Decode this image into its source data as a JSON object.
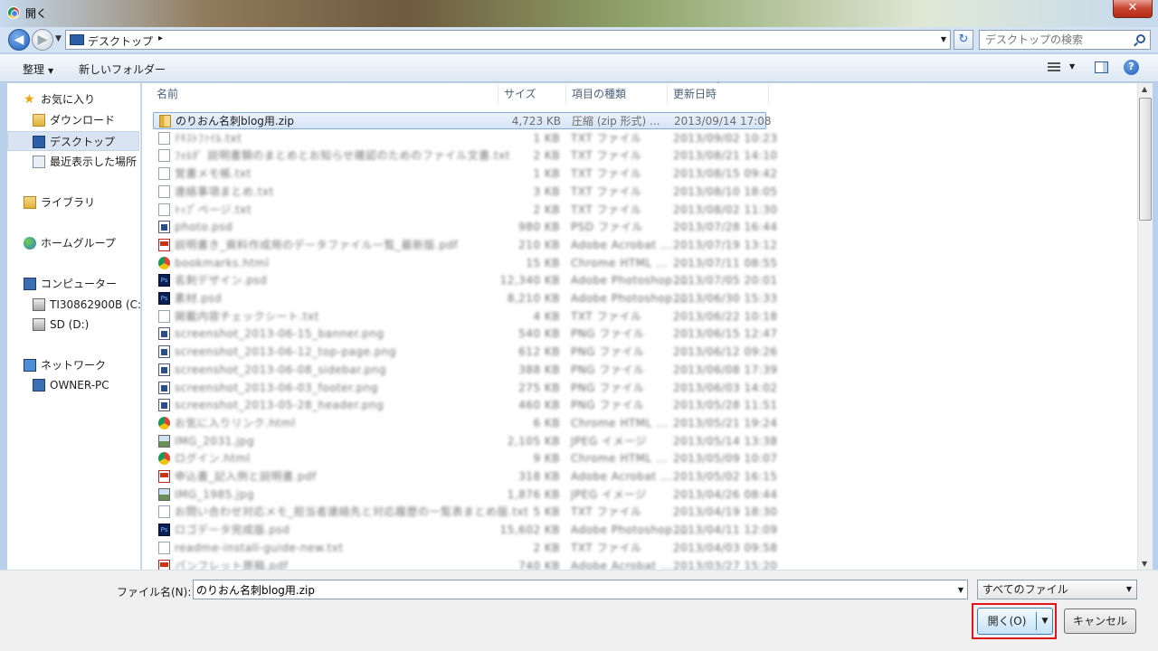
{
  "window": {
    "title": "開く",
    "close_glyph": "✕"
  },
  "address": {
    "back_glyph": "◀",
    "forward_glyph": "▶",
    "dropdown_glyph": "▼",
    "path_label": "デスクトップ",
    "path_arrow": "▸",
    "refresh_glyph": "↻",
    "search_placeholder": "デスクトップの検索"
  },
  "toolbar": {
    "organize_label": "整理",
    "dropdown_glyph": "▼",
    "new_folder_label": "新しいフォルダー",
    "help_glyph": "?"
  },
  "sidebar": {
    "items": [
      {
        "label": "お気に入り",
        "icon": "star-icon"
      },
      {
        "label": "ダウンロード",
        "icon": "folder-icon"
      },
      {
        "label": "デスクトップ",
        "icon": "desktop-icon",
        "selected": true
      },
      {
        "label": "最近表示した場所",
        "icon": "recent-places-icon"
      },
      {
        "label": "ライブラリ",
        "icon": "library-icon"
      },
      {
        "label": "ホームグループ",
        "icon": "homegroup-icon"
      },
      {
        "label": "コンピューター",
        "icon": "computer-icon"
      },
      {
        "label": "TI30862900B (C:)",
        "icon": "drive-icon"
      },
      {
        "label": "SD (D:)",
        "icon": "drive-icon"
      },
      {
        "label": "ネットワーク",
        "icon": "network-icon"
      },
      {
        "label": "OWNER-PC",
        "icon": "pc-icon"
      }
    ]
  },
  "columns": {
    "name": "名前",
    "size": "サイズ",
    "type": "項目の種類",
    "date": "更新日時",
    "sort_glyph": "ˇ"
  },
  "files": [
    {
      "name": "のりおん名刺blog用.zip",
      "size": "4,723 KB",
      "type": "圧縮 (zip 形式) ...",
      "date": "2013/09/14 17:08",
      "icon": "zip",
      "selected": true
    },
    {
      "name": "ﾃｷｽﾄﾌｧｲﾙ.txt",
      "size": "1 KB",
      "type": "TXT ファイル",
      "date": "2013/09/02 10:23",
      "icon": "doc",
      "blurred": true
    },
    {
      "name": "ﾌｫﾙﾀﾞ 説明書類のまとめとお知らせ確認のためのファイル文書.txt",
      "size": "2 KB",
      "type": "TXT ファイル",
      "date": "2013/08/21 14:10",
      "icon": "doc",
      "blurred": true
    },
    {
      "name": "覚書メモ帳.txt",
      "size": "1 KB",
      "type": "TXT ファイル",
      "date": "2013/08/15 09:42",
      "icon": "doc",
      "blurred": true
    },
    {
      "name": "連絡事項まとめ.txt",
      "size": "3 KB",
      "type": "TXT ファイル",
      "date": "2013/08/10 18:05",
      "icon": "doc",
      "blurred": true
    },
    {
      "name": "ﾄｯﾌﾟページ.txt",
      "size": "2 KB",
      "type": "TXT ファイル",
      "date": "2013/08/02 11:30",
      "icon": "doc",
      "blurred": true
    },
    {
      "name": "photo.psd",
      "size": "980 KB",
      "type": "PSD ファイル",
      "date": "2013/07/28 16:44",
      "icon": "img",
      "blurred": true
    },
    {
      "name": "説明書き_資料作成用のデータファイル一覧_最新版.pdf",
      "size": "210 KB",
      "type": "Adobe Acrobat ...",
      "date": "2013/07/19 13:12",
      "icon": "pdf",
      "blurred": true
    },
    {
      "name": "bookmarks.html",
      "size": "15 KB",
      "type": "Chrome HTML ...",
      "date": "2013/07/11 08:55",
      "icon": "chrome",
      "blurred": true
    },
    {
      "name": "名刺デザイン.psd",
      "size": "12,340 KB",
      "type": "Adobe Photoshop ...",
      "date": "2013/07/05 20:01",
      "icon": "ps",
      "blurred": true
    },
    {
      "name": "素材.psd",
      "size": "8,210 KB",
      "type": "Adobe Photoshop ...",
      "date": "2013/06/30 15:33",
      "icon": "ps",
      "blurred": true
    },
    {
      "name": "掲載内容チェックシート.txt",
      "size": "4 KB",
      "type": "TXT ファイル",
      "date": "2013/06/22 10:18",
      "icon": "doc",
      "blurred": true
    },
    {
      "name": "screenshot_2013-06-15_banner.png",
      "size": "540 KB",
      "type": "PNG ファイル",
      "date": "2013/06/15 12:47",
      "icon": "img",
      "blurred": true
    },
    {
      "name": "screenshot_2013-06-12_top-page.png",
      "size": "612 KB",
      "type": "PNG ファイル",
      "date": "2013/06/12 09:26",
      "icon": "img",
      "blurred": true
    },
    {
      "name": "screenshot_2013-06-08_sidebar.png",
      "size": "388 KB",
      "type": "PNG ファイル",
      "date": "2013/06/08 17:39",
      "icon": "img",
      "blurred": true
    },
    {
      "name": "screenshot_2013-06-03_footer.png",
      "size": "275 KB",
      "type": "PNG ファイル",
      "date": "2013/06/03 14:02",
      "icon": "img",
      "blurred": true
    },
    {
      "name": "screenshot_2013-05-28_header.png",
      "size": "460 KB",
      "type": "PNG ファイル",
      "date": "2013/05/28 11:51",
      "icon": "img",
      "blurred": true
    },
    {
      "name": "お気に入りリンク.html",
      "size": "6 KB",
      "type": "Chrome HTML ...",
      "date": "2013/05/21 19:24",
      "icon": "chrome",
      "blurred": true
    },
    {
      "name": "IMG_2031.jpg",
      "size": "2,105 KB",
      "type": "JPEG イメージ",
      "date": "2013/05/14 13:38",
      "icon": "pic",
      "blurred": true
    },
    {
      "name": "ログイン.html",
      "size": "9 KB",
      "type": "Chrome HTML ...",
      "date": "2013/05/09 10:07",
      "icon": "chrome",
      "blurred": true
    },
    {
      "name": "申込書_記入例と説明書.pdf",
      "size": "318 KB",
      "type": "Adobe Acrobat ...",
      "date": "2013/05/02 16:15",
      "icon": "pdf",
      "blurred": true
    },
    {
      "name": "IMG_1985.jpg",
      "size": "1,876 KB",
      "type": "JPEG イメージ",
      "date": "2013/04/26 08:44",
      "icon": "pic",
      "blurred": true
    },
    {
      "name": "お問い合わせ対応メモ_担当者連絡先と対応履歴の一覧表まとめ版.txt",
      "size": "5 KB",
      "type": "TXT ファイル",
      "date": "2013/04/19 18:30",
      "icon": "doc",
      "blurred": true
    },
    {
      "name": "ロゴデータ完成版.psd",
      "size": "15,602 KB",
      "type": "Adobe Photoshop ...",
      "date": "2013/04/11 12:09",
      "icon": "ps",
      "blurred": true
    },
    {
      "name": "readme-install-guide-new.txt",
      "size": "2 KB",
      "type": "TXT ファイル",
      "date": "2013/04/03 09:58",
      "icon": "doc",
      "blurred": true
    },
    {
      "name": "パンフレット原稿.pdf",
      "size": "740 KB",
      "type": "Adobe Acrobat ...",
      "date": "2013/03/27 15:20",
      "icon": "pdf",
      "blurred": true
    }
  ],
  "scrollbar": {
    "up_glyph": "▲",
    "down_glyph": "▼"
  },
  "footer": {
    "filename_label": "ファイル名(N):",
    "filename_value": "のりおん名刺blog用.zip",
    "filename_dropdown_glyph": "▼",
    "filter_value": "すべてのファイル",
    "filter_dropdown_glyph": "▼",
    "open_label": "開く(O)",
    "open_dropdown_glyph": "▼",
    "cancel_label": "キャンセル"
  },
  "colors": {
    "selection": "#d5e4f7",
    "highlight_border": "#e0151a",
    "toolbar": "#dde8f4"
  }
}
